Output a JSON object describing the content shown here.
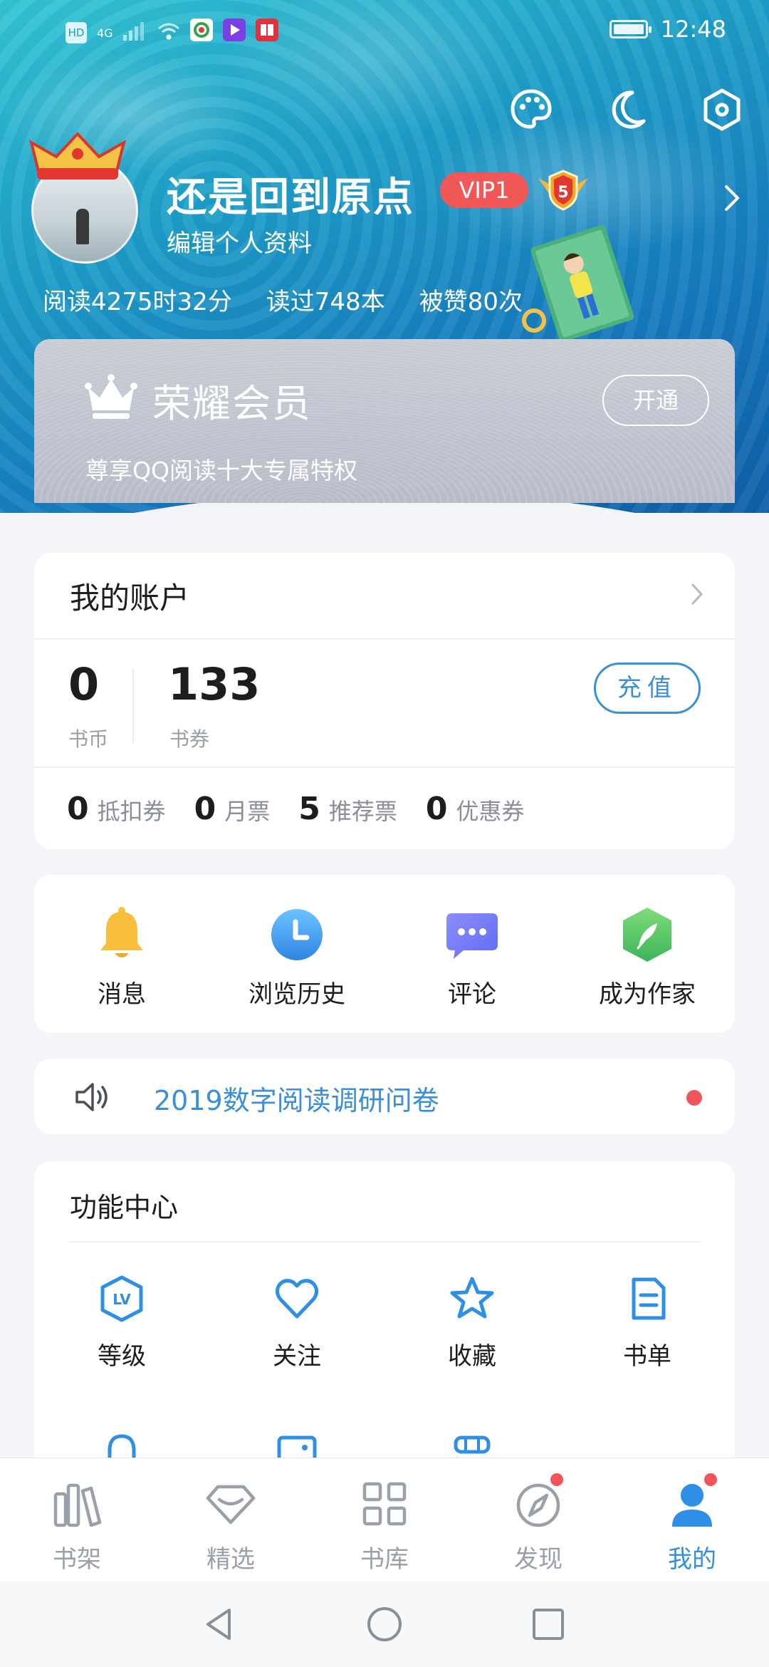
{
  "status_bar": {
    "network": "4G",
    "hd": "HD",
    "time": "12:48"
  },
  "header": {
    "username": "还是回到原点",
    "vip_label": "VIP1",
    "level": "5",
    "edit_profile": "编辑个人资料",
    "stats": [
      "阅读4275时32分",
      "读过748本",
      "被赞80次"
    ]
  },
  "vip_card": {
    "title": "荣耀会员",
    "description": "尊享QQ阅读十大专属特权",
    "button": "开通"
  },
  "account": {
    "title": "我的账户",
    "coins_value": "0",
    "coins_label": "书币",
    "vouchers_value": "133",
    "vouchers_label": "书券",
    "recharge_label": "充值",
    "tickets": [
      {
        "value": "0",
        "label": "抵扣券"
      },
      {
        "value": "0",
        "label": "月票"
      },
      {
        "value": "5",
        "label": "推荐票"
      },
      {
        "value": "0",
        "label": "优惠券"
      }
    ]
  },
  "quick_actions": [
    {
      "label": "消息",
      "icon": "bell-icon"
    },
    {
      "label": "浏览历史",
      "icon": "clock-icon"
    },
    {
      "label": "评论",
      "icon": "comment-icon"
    },
    {
      "label": "成为作家",
      "icon": "feather-icon"
    }
  ],
  "notice": {
    "text": "2019数字阅读调研问卷"
  },
  "function_center": {
    "title": "功能中心",
    "items": [
      {
        "label": "等级",
        "icon": "level-icon"
      },
      {
        "label": "关注",
        "icon": "heart-icon"
      },
      {
        "label": "收藏",
        "icon": "star-icon"
      },
      {
        "label": "书单",
        "icon": "booklist-icon"
      }
    ]
  },
  "tabs": [
    {
      "label": "书架",
      "icon": "bookshelf-icon"
    },
    {
      "label": "精选",
      "icon": "diamond-icon"
    },
    {
      "label": "书库",
      "icon": "grid-icon"
    },
    {
      "label": "发现",
      "icon": "compass-icon"
    },
    {
      "label": "我的",
      "icon": "user-icon"
    }
  ],
  "colors": {
    "accent": "#3a8fd8",
    "vip_red": "#f25757",
    "active_tab": "#2f8fe6",
    "notification_dot": "#f2545b"
  }
}
